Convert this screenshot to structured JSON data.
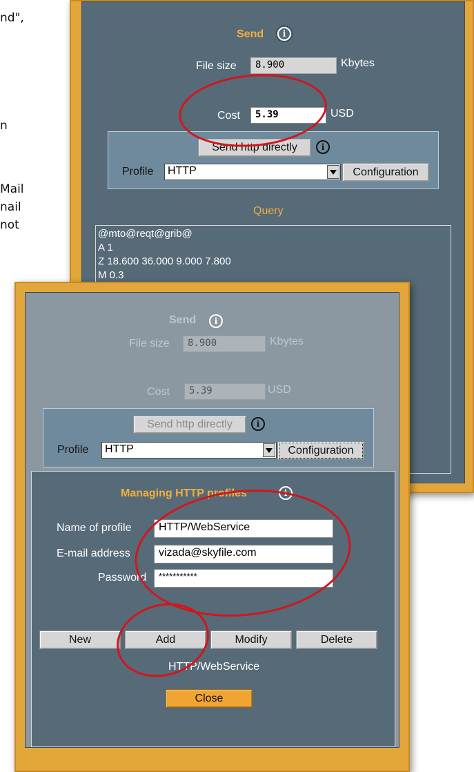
{
  "bg_text": [
    "nd\",",
    "n",
    "Mail",
    "nail",
    "not"
  ],
  "top": {
    "send_title": "Send",
    "file_size_label": "File size",
    "file_size_value": "8.900",
    "file_size_unit": "Kbytes",
    "cost_label": "Cost",
    "cost_value": "5.39",
    "cost_unit": "USD",
    "send_button": "Send http directly",
    "profile_label": "Profile",
    "profile_value": "HTTP",
    "configuration_button": "Configuration",
    "query_title": "Query",
    "query_lines": [
      "@mto@reqt@grib@",
      "A 1",
      "Z 18.600 36.000 9.000 7.800",
      "M 0.3"
    ]
  },
  "bottom": {
    "send_title": "Send",
    "file_size_label": "File size",
    "file_size_value": "8.900",
    "file_size_unit": "Kbytes",
    "cost_label": "Cost",
    "cost_value": "5.39",
    "cost_unit": "USD",
    "send_button": "Send http directly",
    "profile_label": "Profile",
    "profile_value": "HTTP",
    "configuration_button": "Configuration"
  },
  "manage": {
    "title": "Managing HTTP profiles",
    "name_label": "Name of profile",
    "name_value": "HTTP/WebService",
    "email_label": "E-mail address",
    "email_value": "vizada@skyfile.com",
    "password_label": "Password",
    "password_value": "***********",
    "new_button": "New",
    "add_button": "Add",
    "modify_button": "Modify",
    "delete_button": "Delete",
    "profile_name": "HTTP/WebService",
    "close_button": "Close"
  },
  "colors": {
    "frame": "#e3a63a",
    "panel": "#566a78",
    "accent": "#f2b03c",
    "highlight_circle": "#d2161c"
  }
}
